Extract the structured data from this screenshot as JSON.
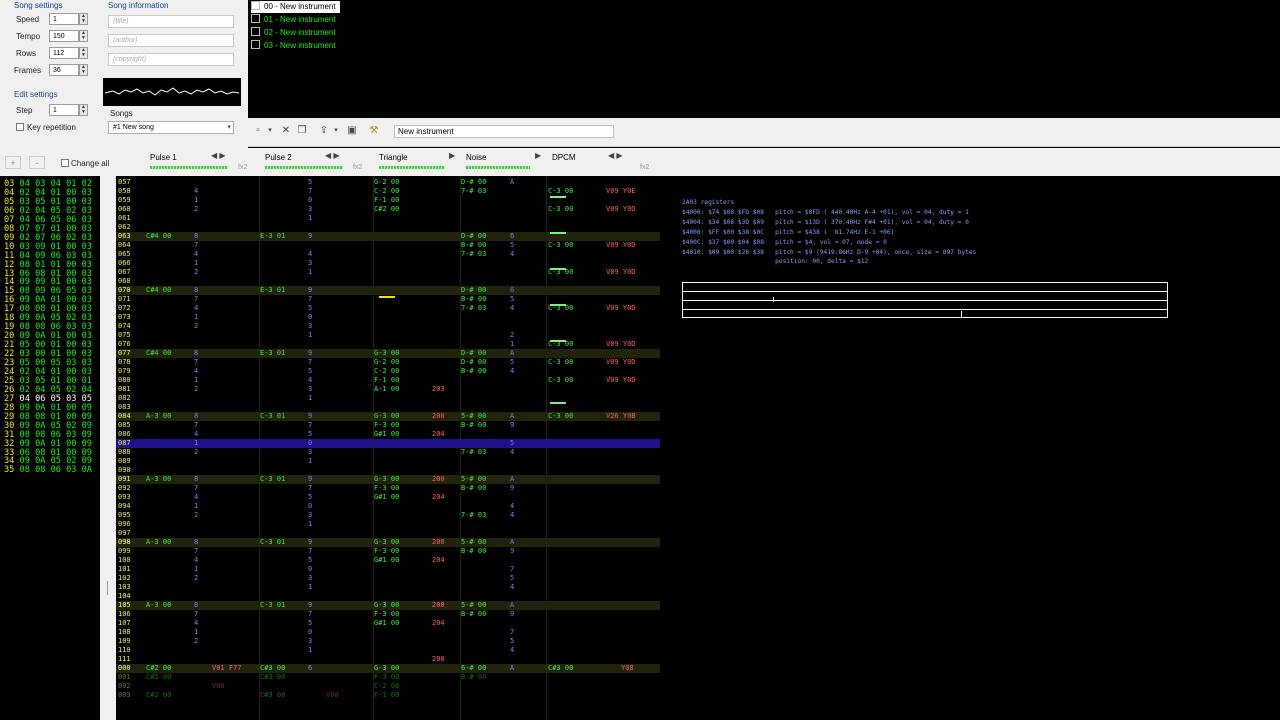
{
  "song_settings": {
    "title": "Song settings",
    "speed_label": "Speed",
    "speed": "1",
    "tempo_label": "Tempo",
    "tempo": "150",
    "rows_label": "Rows",
    "rows": "112",
    "frames_label": "Frames",
    "frames": "36"
  },
  "song_info": {
    "title": "Song information",
    "title_placeholder": "(title)",
    "author_placeholder": "(author)",
    "copyright_placeholder": "(copyright)"
  },
  "edit_settings": {
    "title": "Edit settings",
    "step_label": "Step",
    "step": "1",
    "key_repetition": "Key repetition"
  },
  "songs": {
    "label": "Songs",
    "selected": "#1 New song"
  },
  "instruments": [
    "00 - New instrument",
    "01 - New instrument",
    "02 - New instrument",
    "03 - New instrument"
  ],
  "toolbar": {
    "instrument_name": "New instrument"
  },
  "frame_tools": {
    "plus": "+",
    "minus": "-",
    "change_all": "Change all"
  },
  "frames": [
    [
      "03",
      "04 03 04 01 02"
    ],
    [
      "04",
      "02 04 01 00 03"
    ],
    [
      "05",
      "03 05 01 00 03"
    ],
    [
      "06",
      "02 04 05 02 03"
    ],
    [
      "07",
      "04 06 05 06 03"
    ],
    [
      "08",
      "07 07 01 00 03"
    ],
    [
      "09",
      "02 07 06 02 03"
    ],
    [
      "10",
      "03 09 01 00 03"
    ],
    [
      "11",
      "04 09 06 03 03"
    ],
    [
      "12",
      "08 01 01 00 03"
    ],
    [
      "13",
      "06 08 01 00 03"
    ],
    [
      "14",
      "09 09 01 00 03"
    ],
    [
      "15",
      "08 09 06 05 03"
    ],
    [
      "16",
      "09 0A 01 00 03"
    ],
    [
      "17",
      "08 08 01 00 03"
    ],
    [
      "18",
      "09 0A 05 02 03"
    ],
    [
      "19",
      "08 08 06 03 03"
    ],
    [
      "20",
      "09 0A 01 00 03"
    ],
    [
      "21",
      "05 00 01 00 03"
    ],
    [
      "22",
      "03 00 01 00 03"
    ],
    [
      "23",
      "05 00 05 03 03"
    ],
    [
      "24",
      "02 04 01 00 03"
    ],
    [
      "25",
      "03 05 01 00 01"
    ],
    [
      "26",
      "02 04 05 02 04"
    ],
    [
      "27",
      "04 06 05 03 05"
    ],
    [
      "28",
      "09 0A 01 00 09"
    ],
    [
      "29",
      "08 08 01 00 09"
    ],
    [
      "30",
      "09 0A 05 02 09"
    ],
    [
      "31",
      "08 08 06 03 09"
    ],
    [
      "32",
      "09 0A 01 00 09"
    ],
    [
      "33",
      "06 08 01 00 09"
    ],
    [
      "34",
      "09 0A 05 02 09"
    ],
    [
      "35",
      "08 08 06 03 0A"
    ]
  ],
  "channels": [
    {
      "name": "Pulse 1",
      "fx": "fx2"
    },
    {
      "name": "Pulse 2",
      "fx": "fx2"
    },
    {
      "name": "Triangle",
      "fx": ""
    },
    {
      "name": "Noise",
      "fx": ""
    },
    {
      "name": "DPCM",
      "fx": "fx2"
    }
  ],
  "pattern_rows": [
    {
      "n": "057",
      "c": [
        "",
        "",
        "G-2 00",
        "D-# 00",
        ""
      ],
      "v": [
        "",
        "5",
        "",
        "A",
        ""
      ],
      "e": [
        "",
        "",
        "",
        "",
        ""
      ]
    },
    {
      "n": "058",
      "c": [
        "",
        "",
        "C-2 00",
        "7-# 03",
        "C-3 00"
      ],
      "v": [
        "4",
        "7",
        "",
        "",
        "V09 Y0E"
      ],
      "e": [
        "",
        "",
        "",
        "",
        ""
      ]
    },
    {
      "n": "059",
      "c": [
        "",
        "",
        "F-1 00",
        "",
        ""
      ],
      "v": [
        "1",
        "0",
        "",
        "",
        ""
      ],
      "e": [
        "",
        "",
        "",
        "",
        ""
      ]
    },
    {
      "n": "060",
      "c": [
        "",
        "",
        "C#2 00",
        "",
        "C-3 00"
      ],
      "v": [
        "2",
        "3",
        "",
        "",
        "V09 Y0D"
      ],
      "e": [
        "",
        "",
        "",
        "",
        ""
      ]
    },
    {
      "n": "061",
      "c": [
        "",
        "",
        "",
        "",
        ""
      ],
      "v": [
        "",
        "1",
        "",
        "",
        ""
      ],
      "e": [
        "",
        "",
        "",
        "",
        ""
      ]
    },
    {
      "n": "062",
      "c": [
        "",
        "",
        "",
        "",
        ""
      ],
      "v": [
        "",
        "",
        "",
        "",
        ""
      ],
      "e": [
        "",
        "",
        "",
        "",
        ""
      ]
    },
    {
      "n": "063",
      "c": [
        "C#4 00",
        "E-3 01",
        "",
        "D-# 00",
        ""
      ],
      "v": [
        "8",
        "9",
        "",
        "6",
        ""
      ],
      "e": [
        "",
        "",
        "",
        "",
        ""
      ]
    },
    {
      "n": "064",
      "c": [
        "",
        "",
        "",
        "B-# 00",
        "C-3 00"
      ],
      "v": [
        "7",
        "",
        "",
        "5",
        "V09 Y0D"
      ],
      "e": [
        "",
        "",
        "",
        "",
        ""
      ]
    },
    {
      "n": "065",
      "c": [
        "",
        "",
        "",
        "7-# 03",
        ""
      ],
      "v": [
        "4",
        "4",
        "",
        "4",
        ""
      ],
      "e": [
        "",
        "",
        "",
        "",
        ""
      ]
    },
    {
      "n": "066",
      "c": [
        "",
        "",
        "",
        "",
        ""
      ],
      "v": [
        "1",
        "3",
        "",
        "",
        ""
      ],
      "e": [
        "",
        "",
        "",
        "",
        ""
      ]
    },
    {
      "n": "067",
      "c": [
        "",
        "",
        "",
        "",
        "C-3 00"
      ],
      "v": [
        "2",
        "1",
        "",
        "",
        "V09 Y0D"
      ],
      "e": [
        "",
        "",
        "",
        "",
        ""
      ]
    },
    {
      "n": "068",
      "c": [
        "",
        "",
        "",
        "",
        ""
      ],
      "v": [
        "",
        "",
        "",
        "",
        ""
      ],
      "e": [
        "",
        "",
        "",
        "",
        ""
      ]
    },
    {
      "n": "070",
      "c": [
        "C#4 00",
        "E-3 01",
        "",
        "D-# 00",
        ""
      ],
      "v": [
        "8",
        "9",
        "",
        "6",
        ""
      ],
      "e": [
        "",
        "",
        "",
        "",
        ""
      ]
    },
    {
      "n": "071",
      "c": [
        "",
        "",
        "",
        "B-# 00",
        ""
      ],
      "v": [
        "7",
        "7",
        "",
        "5",
        ""
      ],
      "e": [
        "",
        "",
        "",
        "",
        ""
      ]
    },
    {
      "n": "072",
      "c": [
        "",
        "",
        "",
        "7-# 03",
        "C-3 00"
      ],
      "v": [
        "4",
        "5",
        "",
        "4",
        "V09 Y0D"
      ],
      "e": [
        "",
        "",
        "",
        "",
        ""
      ]
    },
    {
      "n": "073",
      "c": [
        "",
        "",
        "",
        "",
        ""
      ],
      "v": [
        "1",
        "0",
        "",
        "",
        ""
      ],
      "e": [
        "",
        "",
        "",
        "",
        ""
      ]
    },
    {
      "n": "074",
      "c": [
        "",
        "",
        "",
        "",
        ""
      ],
      "v": [
        "2",
        "3",
        "",
        "",
        ""
      ],
      "e": [
        "",
        "",
        "",
        "",
        ""
      ]
    },
    {
      "n": "075",
      "c": [
        "",
        "",
        "",
        "",
        ""
      ],
      "v": [
        "",
        "1",
        "",
        "2",
        ""
      ],
      "e": [
        "",
        "",
        "",
        "",
        ""
      ]
    },
    {
      "n": "076",
      "c": [
        "",
        "",
        "",
        "",
        "C-3 00"
      ],
      "v": [
        "",
        "",
        "",
        "1",
        "V09 Y0D"
      ],
      "e": [
        "",
        "",
        "",
        "",
        ""
      ]
    },
    {
      "n": "077",
      "c": [
        "C#4 00",
        "E-3 01",
        "G-3 00",
        "D-# 00",
        ""
      ],
      "v": [
        "8",
        "9",
        "",
        "A",
        ""
      ],
      "e": [
        "",
        "",
        "",
        "",
        ""
      ]
    },
    {
      "n": "078",
      "c": [
        "",
        "",
        "G-2 00",
        "D-# 00",
        "C-3 00"
      ],
      "v": [
        "7",
        "7",
        "",
        "5",
        "V09 Y0D"
      ],
      "e": [
        "",
        "",
        "",
        "",
        ""
      ]
    },
    {
      "n": "079",
      "c": [
        "",
        "",
        "C-2 00",
        "B-# 00",
        ""
      ],
      "v": [
        "4",
        "5",
        "",
        "4",
        ""
      ],
      "e": [
        "",
        "",
        "",
        "",
        ""
      ]
    },
    {
      "n": "080",
      "c": [
        "",
        "",
        "F-1 00",
        "",
        "C-3 00"
      ],
      "v": [
        "1",
        "4",
        "",
        "",
        "V09 Y0D"
      ],
      "e": [
        "",
        "",
        "",
        "",
        ""
      ]
    },
    {
      "n": "081",
      "c": [
        "",
        "",
        "A-1 00",
        "",
        ""
      ],
      "v": [
        "2",
        "3",
        "",
        "",
        ""
      ],
      "e": [
        "",
        "",
        "203",
        "",
        ""
      ]
    },
    {
      "n": "082",
      "c": [
        "",
        "",
        "",
        "",
        ""
      ],
      "v": [
        "",
        "1",
        "",
        "",
        ""
      ],
      "e": [
        "",
        "",
        "",
        "",
        ""
      ]
    },
    {
      "n": "083",
      "c": [
        "",
        "",
        "",
        "",
        ""
      ],
      "v": [
        "",
        "",
        "",
        "",
        ""
      ],
      "e": [
        "",
        "",
        "",
        "",
        ""
      ]
    },
    {
      "n": "084",
      "c": [
        "A-3 00",
        "C-3 01",
        "G-3 00",
        "5-# 00",
        "C-3 00"
      ],
      "v": [
        "8",
        "9",
        "",
        "A",
        "V26 Y0B"
      ],
      "e": [
        "",
        "",
        "200",
        "",
        ""
      ]
    },
    {
      "n": "085",
      "c": [
        "",
        "",
        "F-3 00",
        "B-# 00",
        ""
      ],
      "v": [
        "7",
        "7",
        "",
        "9",
        ""
      ],
      "e": [
        "",
        "",
        "",
        "",
        ""
      ]
    },
    {
      "n": "086",
      "c": [
        "",
        "",
        "G#1 00",
        "",
        ""
      ],
      "v": [
        "4",
        "5",
        "",
        "",
        ""
      ],
      "e": [
        "",
        "",
        "204",
        "",
        ""
      ]
    },
    {
      "n": "087",
      "c": [
        "",
        "",
        "",
        "",
        ""
      ],
      "v": [
        "1",
        "0",
        "",
        "5",
        ""
      ],
      "e": [
        "",
        "",
        "",
        "",
        ""
      ]
    },
    {
      "n": "088",
      "c": [
        "",
        "",
        "",
        "7-# 03",
        ""
      ],
      "v": [
        "2",
        "3",
        "",
        "4",
        ""
      ],
      "e": [
        "",
        "",
        "",
        "",
        ""
      ]
    },
    {
      "n": "089",
      "c": [
        "",
        "",
        "",
        "",
        ""
      ],
      "v": [
        "",
        "1",
        "",
        "",
        ""
      ],
      "e": [
        "",
        "",
        "",
        "",
        ""
      ]
    },
    {
      "n": "090",
      "c": [
        "",
        "",
        "",
        "",
        ""
      ],
      "v": [
        "",
        "",
        "",
        "",
        ""
      ],
      "e": [
        "",
        "",
        "",
        "",
        ""
      ]
    },
    {
      "n": "091",
      "c": [
        "A-3 00",
        "C-3 01",
        "G-3 00",
        "5-# 00",
        ""
      ],
      "v": [
        "8",
        "9",
        "",
        "A",
        ""
      ],
      "e": [
        "",
        "",
        "200",
        "",
        ""
      ]
    },
    {
      "n": "092",
      "c": [
        "",
        "",
        "F-3 00",
        "B-# 00",
        ""
      ],
      "v": [
        "7",
        "7",
        "",
        "9",
        ""
      ],
      "e": [
        "",
        "",
        "",
        "",
        ""
      ]
    },
    {
      "n": "093",
      "c": [
        "",
        "",
        "G#1 00",
        "",
        ""
      ],
      "v": [
        "4",
        "5",
        "",
        "",
        ""
      ],
      "e": [
        "",
        "",
        "204",
        "",
        ""
      ]
    },
    {
      "n": "094",
      "c": [
        "",
        "",
        "",
        "",
        ""
      ],
      "v": [
        "1",
        "0",
        "",
        "4",
        ""
      ],
      "e": [
        "",
        "",
        "",
        "",
        ""
      ]
    },
    {
      "n": "095",
      "c": [
        "",
        "",
        "",
        "7-# 03",
        ""
      ],
      "v": [
        "2",
        "3",
        "",
        "4",
        ""
      ],
      "e": [
        "",
        "",
        "",
        "",
        ""
      ]
    },
    {
      "n": "096",
      "c": [
        "",
        "",
        "",
        "",
        ""
      ],
      "v": [
        "",
        "1",
        "",
        "",
        ""
      ],
      "e": [
        "",
        "",
        "",
        "",
        ""
      ]
    },
    {
      "n": "097",
      "c": [
        "",
        "",
        "",
        "",
        ""
      ],
      "v": [
        "",
        "",
        "",
        "",
        ""
      ],
      "e": [
        "",
        "",
        "",
        "",
        ""
      ]
    },
    {
      "n": "098",
      "c": [
        "A-3 00",
        "C-3 01",
        "G-3 00",
        "5-# 00",
        ""
      ],
      "v": [
        "8",
        "9",
        "",
        "A",
        ""
      ],
      "e": [
        "",
        "",
        "200",
        "",
        ""
      ]
    },
    {
      "n": "099",
      "c": [
        "",
        "",
        "F-3 00",
        "B-# 00",
        ""
      ],
      "v": [
        "7",
        "7",
        "",
        "9",
        ""
      ],
      "e": [
        "",
        "",
        "",
        "",
        ""
      ]
    },
    {
      "n": "100",
      "c": [
        "",
        "",
        "G#1 00",
        "",
        ""
      ],
      "v": [
        "4",
        "5",
        "",
        "",
        ""
      ],
      "e": [
        "",
        "",
        "204",
        "",
        ""
      ]
    },
    {
      "n": "101",
      "c": [
        "",
        "",
        "",
        "",
        ""
      ],
      "v": [
        "1",
        "0",
        "",
        "7",
        ""
      ],
      "e": [
        "",
        "",
        "",
        "",
        ""
      ]
    },
    {
      "n": "102",
      "c": [
        "",
        "",
        "",
        "",
        ""
      ],
      "v": [
        "2",
        "3",
        "",
        "5",
        ""
      ],
      "e": [
        "",
        "",
        "",
        "",
        ""
      ]
    },
    {
      "n": "103",
      "c": [
        "",
        "",
        "",
        "",
        ""
      ],
      "v": [
        "",
        "1",
        "",
        "4",
        ""
      ],
      "e": [
        "",
        "",
        "",
        "",
        ""
      ]
    },
    {
      "n": "104",
      "c": [
        "",
        "",
        "",
        "",
        ""
      ],
      "v": [
        "",
        "",
        "",
        "",
        ""
      ],
      "e": [
        "",
        "",
        "",
        "",
        ""
      ]
    },
    {
      "n": "105",
      "c": [
        "A-3 00",
        "C-3 01",
        "G-3 00",
        "5-# 00",
        ""
      ],
      "v": [
        "8",
        "9",
        "",
        "A",
        ""
      ],
      "e": [
        "",
        "",
        "200",
        "",
        ""
      ]
    },
    {
      "n": "106",
      "c": [
        "",
        "",
        "F-3 00",
        "B-# 00",
        ""
      ],
      "v": [
        "7",
        "7",
        "",
        "9",
        ""
      ],
      "e": [
        "",
        "",
        "",
        "",
        ""
      ]
    },
    {
      "n": "107",
      "c": [
        "",
        "",
        "G#1 00",
        "",
        ""
      ],
      "v": [
        "4",
        "5",
        "",
        "",
        ""
      ],
      "e": [
        "",
        "",
        "204",
        "",
        ""
      ]
    },
    {
      "n": "108",
      "c": [
        "",
        "",
        "",
        "",
        ""
      ],
      "v": [
        "1",
        "0",
        "",
        "7",
        ""
      ],
      "e": [
        "",
        "",
        "",
        "",
        ""
      ]
    },
    {
      "n": "109",
      "c": [
        "",
        "",
        "",
        "",
        ""
      ],
      "v": [
        "2",
        "3",
        "",
        "5",
        ""
      ],
      "e": [
        "",
        "",
        "",
        "",
        ""
      ]
    },
    {
      "n": "110",
      "c": [
        "",
        "",
        "",
        "",
        ""
      ],
      "v": [
        "",
        "1",
        "",
        "4",
        ""
      ],
      "e": [
        "",
        "",
        "",
        "",
        ""
      ]
    },
    {
      "n": "111",
      "c": [
        "",
        "",
        "",
        "",
        ""
      ],
      "v": [
        "",
        "",
        "",
        "",
        ""
      ],
      "e": [
        "",
        "",
        "200",
        "",
        ""
      ]
    },
    {
      "n": "000",
      "c": [
        "C#2 00",
        "C#3 00",
        "G-3 00",
        "6-# 00",
        "C#3 00"
      ],
      "v": [
        "",
        "6",
        "",
        "A",
        ""
      ],
      "e": [
        "V01 F77",
        "",
        "",
        "",
        "Y08"
      ]
    },
    {
      "n": "001",
      "c": [
        "C#2 00",
        "C#3 00",
        "F-3 00",
        "B-# 00",
        ""
      ],
      "v": [
        "",
        "",
        "",
        "",
        ""
      ],
      "e": [
        "",
        "",
        "",
        "",
        ""
      ]
    },
    {
      "n": "002",
      "c": [
        "",
        "",
        "C-2 00",
        "",
        ""
      ],
      "v": [
        "",
        "",
        "",
        "",
        ""
      ],
      "e": [
        "V00",
        "",
        "",
        "",
        ""
      ]
    },
    {
      "n": "003",
      "c": [
        "C#2 00",
        "C#3 00",
        "F-1 00",
        "",
        ""
      ],
      "v": [
        "",
        "",
        "",
        "",
        ""
      ],
      "e": [
        "",
        "V00",
        "",
        "",
        ""
      ]
    }
  ],
  "registers": {
    "title": "2A03 registers",
    "lines": [
      "$4000: $74 $08 $FD $08   pitch = $0FD ( 440.40Hz A-4 +01), vol = 04, duty = 1",
      "$4004: $34 $08 $3D $09   pitch = $13D ( 370.40Hz F#4 +01), vol = 04, duty = 0",
      "$4008: $FF $00 $38 $0C   pitch = $438 (  81.74Hz E-1 +06)",
      "$400C: $37 $00 $04 $08   pitch = $4, vol = 07, mode = 0",
      "$4010: $09 $00 $26 $38   pitch = $9 (9419.86Hz D-9 +04), once, size = 897 bytes",
      "                         position: 00, delta = $12"
    ]
  }
}
